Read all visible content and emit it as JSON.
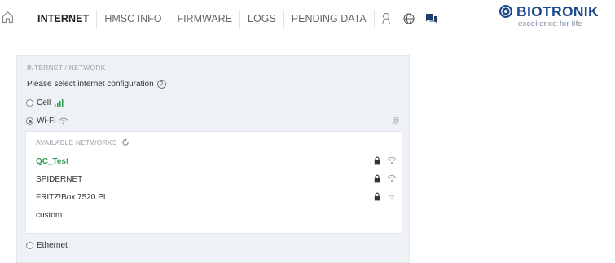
{
  "nav": {
    "items": [
      {
        "label": "INTERNET",
        "active": true
      },
      {
        "label": "HMSC INFO",
        "active": false
      },
      {
        "label": "FIRMWARE",
        "active": false
      },
      {
        "label": "LOGS",
        "active": false
      },
      {
        "label": "PENDING DATA",
        "active": false
      }
    ]
  },
  "brand": {
    "name": "BIOTRONIK",
    "tagline": "excellence for life",
    "color": "#1d4a8c"
  },
  "panel": {
    "title": "INTERNET / NETWORK",
    "prompt": "Please select internet configuration",
    "options": [
      {
        "label": "Cell",
        "selected": false,
        "icon": "signal-bars-icon"
      },
      {
        "label": "Wi-Fi",
        "selected": true,
        "icon": "wifi-icon"
      },
      {
        "label": "Ethernet",
        "selected": false
      }
    ]
  },
  "networks": {
    "title": "AVAILABLE NETWORKS",
    "list": [
      {
        "name": "QC_Test",
        "connected": true,
        "locked": true,
        "signal": "strong"
      },
      {
        "name": "SPIDERNET",
        "connected": false,
        "locked": true,
        "signal": "strong"
      },
      {
        "name": "FRITZ!Box 7520 PI",
        "connected": false,
        "locked": true,
        "signal": "weak"
      },
      {
        "name": "custom",
        "connected": false,
        "locked": false
      }
    ]
  },
  "colors": {
    "connected": "#2e9b4f",
    "panel_bg": "#eef1f5",
    "muted": "#9aa3ad"
  }
}
